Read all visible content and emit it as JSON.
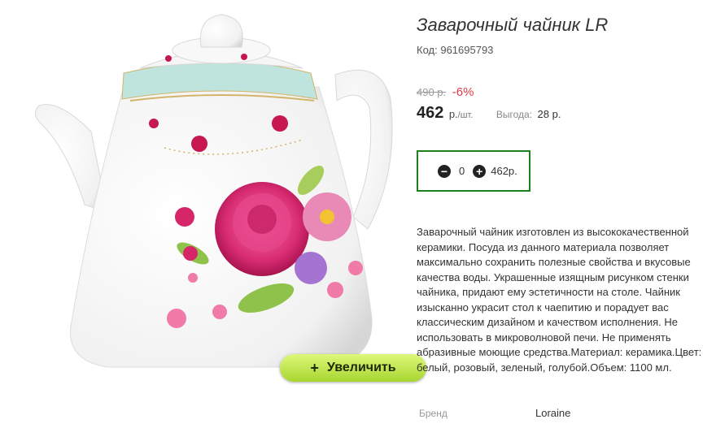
{
  "product": {
    "title": "Заварочный чайник LR",
    "code_label": "Код:",
    "code_value": "961695793",
    "old_price": "490 р.",
    "discount": "-6%",
    "price": "462",
    "price_unit": "р.",
    "price_per": "/шт.",
    "benefit_label": "Выгода:",
    "benefit_value": "28 р."
  },
  "cart": {
    "minus_icon": "minus-circle-icon",
    "plus_icon": "plus-circle-icon",
    "quantity": "0",
    "total": "462р."
  },
  "image": {
    "zoom_plus": "+",
    "zoom_label": "Увеличить"
  },
  "description": "Заварочный чайник изготовлен из высококачественной керамики. Посуда из данного материала позволяет максимально сохранить полезные свойства и вкусовые качества воды. Украшенные изящным рисунком стенки чайника, придают ему эстетичности на столе. Чайник изысканно украсит стол к чаепитию и порадует вас классическим дизайном и качеством исполнения. Не использовать в микроволновой печи. Не применять абразивные моющие средства.Материал: керамика.Цвет: белый, розовый, зеленый, голубой.Объем: 1100 мл.",
  "specs": {
    "brand_label": "Бренд",
    "brand_value": "Loraine"
  },
  "colors": {
    "accent_green": "#1e7f1e",
    "discount_red": "#e23a4a",
    "button_green": "#b5e03a"
  }
}
